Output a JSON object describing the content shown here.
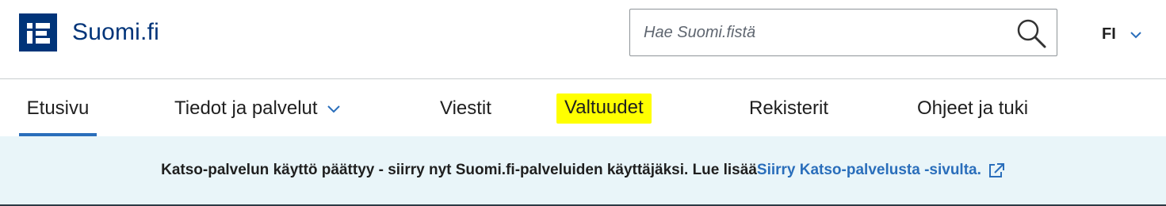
{
  "brand": {
    "name": "Suomi.fi",
    "color": "#003479"
  },
  "search": {
    "placeholder": "Hae Suomi.fistä",
    "icon": "search-icon"
  },
  "language": {
    "current": "FI",
    "icon": "chevron-down-icon"
  },
  "nav": {
    "items": [
      {
        "label": "Etusivu",
        "active": true
      },
      {
        "label": "Tiedot ja palvelut",
        "has_dropdown": true
      },
      {
        "label": "Viestit"
      },
      {
        "label": "Valtuudet",
        "highlighted": true
      },
      {
        "label": "Rekisterit"
      },
      {
        "label": "Ohjeet ja tuki"
      }
    ],
    "active_color": "#2a6ebb",
    "highlight_color": "#ffff00"
  },
  "notice": {
    "text": "Katso-palvelun käyttö päättyy - siirry nyt Suomi.fi-palveluiden käyttäjäksi. Lue lisää",
    "link_text": "Siirry Katso-palvelusta -sivulta.",
    "link_icon": "external-link-icon",
    "background": "#e9f5f9",
    "link_color": "#2a6ebb"
  }
}
